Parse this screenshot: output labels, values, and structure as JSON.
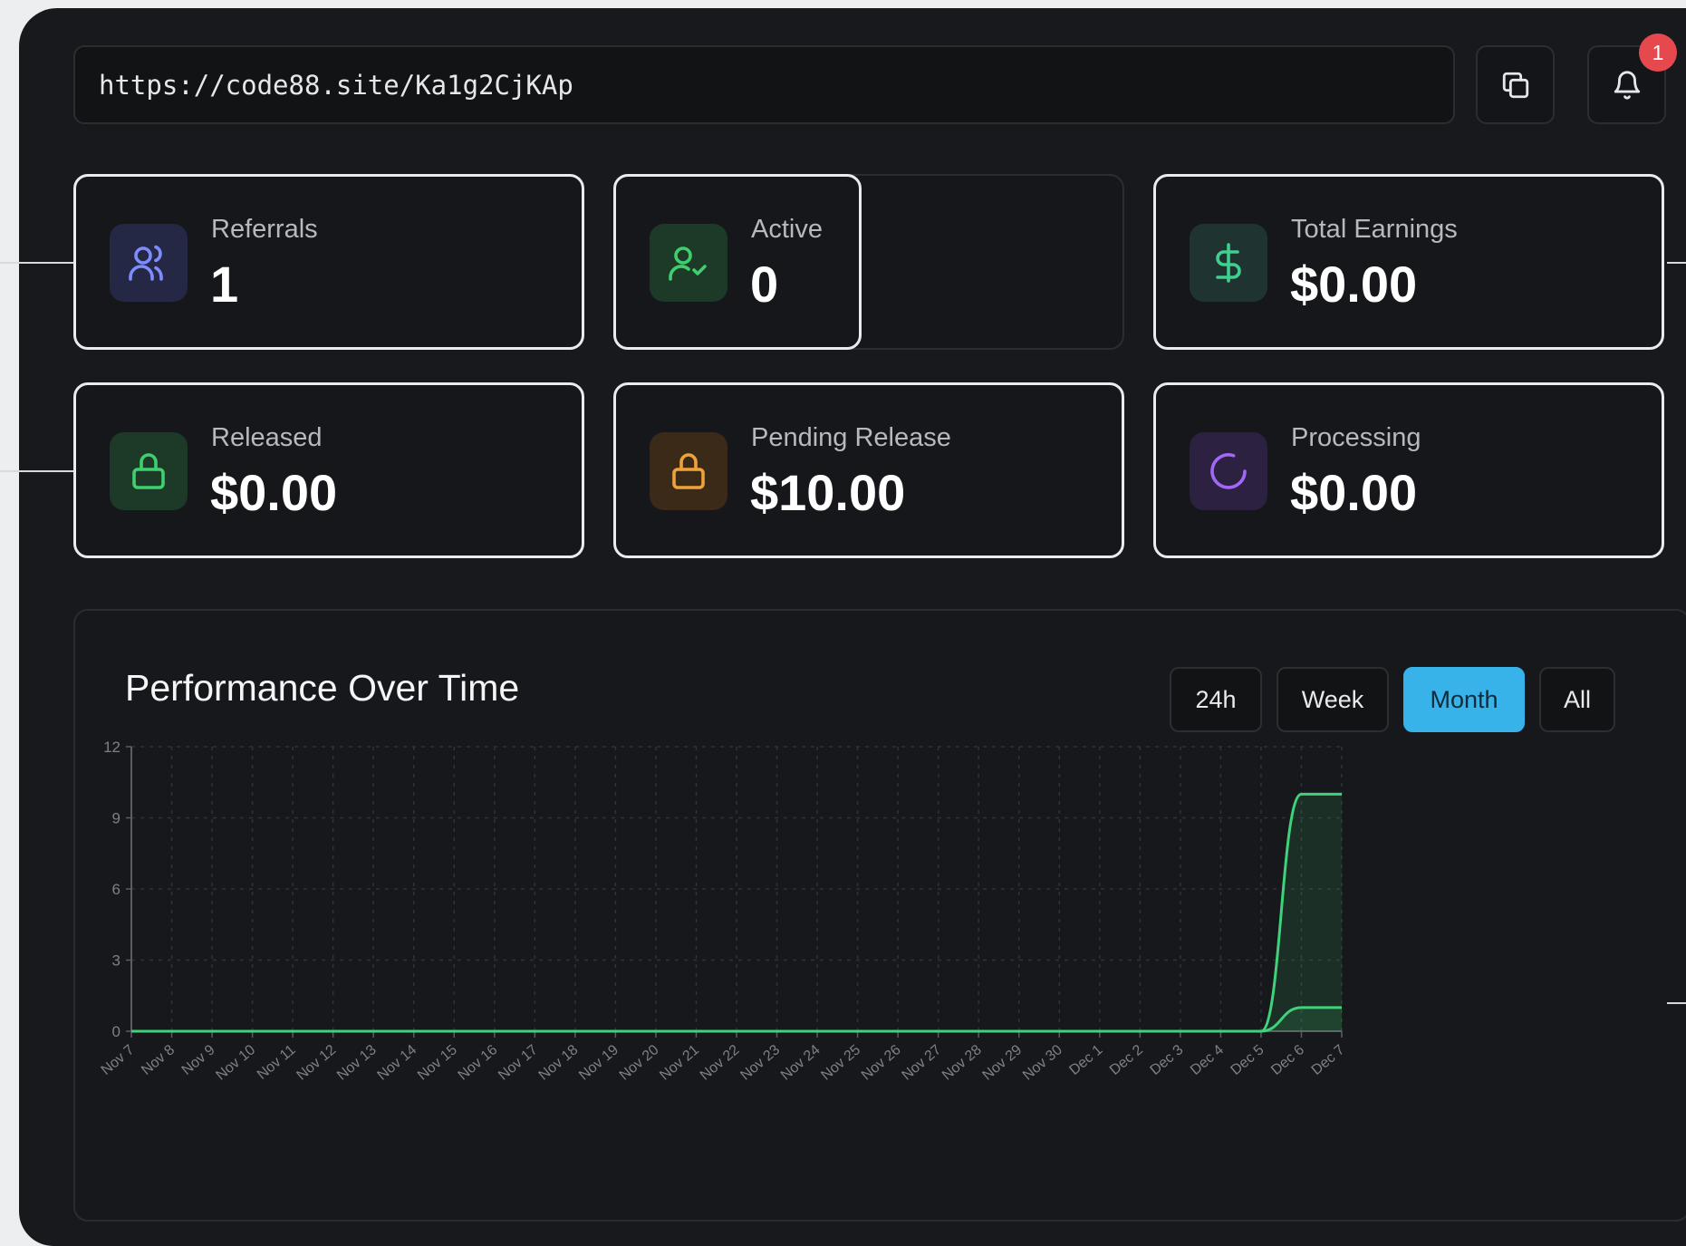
{
  "referral_link": {
    "url": "https://code88.site/Ka1g2CjKAp"
  },
  "toolbar": {
    "copy_icon": "copy-icon",
    "bell_icon": "bell-icon",
    "notification_count": "1",
    "badge_color": "#e5484d"
  },
  "stats": {
    "referrals": {
      "label": "Referrals",
      "value": "1",
      "icon": "users-icon",
      "color": "#7f8cff"
    },
    "active": {
      "label": "Active",
      "value": "0",
      "icon": "user-check-icon",
      "color": "#3fcf6e"
    },
    "total_earnings": {
      "label": "Total Earnings",
      "value": "$0.00",
      "icon": "dollar-icon",
      "color": "#3fcf8e"
    },
    "released": {
      "label": "Released",
      "value": "$0.00",
      "icon": "unlock-icon",
      "color": "#3fcf6e"
    },
    "pending_release": {
      "label": "Pending Release",
      "value": "$10.00",
      "icon": "lock-icon",
      "color": "#f0a23a"
    },
    "processing": {
      "label": "Processing",
      "value": "$0.00",
      "icon": "spinner-icon",
      "color": "#a268f5"
    }
  },
  "performance": {
    "title": "Performance Over Time",
    "ranges": [
      "24h",
      "Week",
      "Month",
      "All"
    ],
    "selected_range": "Month",
    "accent": "#38b3ea"
  },
  "chart_data": {
    "type": "area",
    "x": [
      "Nov 7",
      "Nov 8",
      "Nov 9",
      "Nov 10",
      "Nov 11",
      "Nov 12",
      "Nov 13",
      "Nov 14",
      "Nov 15",
      "Nov 16",
      "Nov 17",
      "Nov 18",
      "Nov 19",
      "Nov 20",
      "Nov 21",
      "Nov 22",
      "Nov 23",
      "Nov 24",
      "Nov 25",
      "Nov 26",
      "Nov 27",
      "Nov 28",
      "Nov 29",
      "Nov 30",
      "Dec 1",
      "Dec 2",
      "Dec 3",
      "Dec 4",
      "Dec 5",
      "Dec 6",
      "Dec 7"
    ],
    "series": [
      {
        "values": [
          0,
          0,
          0,
          0,
          0,
          0,
          0,
          0,
          0,
          0,
          0,
          0,
          0,
          0,
          0,
          0,
          0,
          0,
          0,
          0,
          0,
          0,
          0,
          0,
          0,
          0,
          0,
          0,
          0,
          10,
          10
        ],
        "color": "#3fd27a"
      },
      {
        "values": [
          0,
          0,
          0,
          0,
          0,
          0,
          0,
          0,
          0,
          0,
          0,
          0,
          0,
          0,
          0,
          0,
          0,
          0,
          0,
          0,
          0,
          0,
          0,
          0,
          0,
          0,
          0,
          0,
          0,
          1,
          1
        ],
        "color": "#3fd27a"
      }
    ],
    "ylim": [
      0,
      12
    ],
    "yticks": [
      "0",
      "3",
      "6",
      "9",
      "12"
    ],
    "grid": true,
    "legend": "none"
  }
}
